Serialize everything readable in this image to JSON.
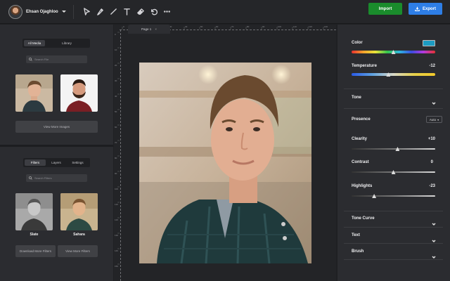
{
  "topbar": {
    "username": "Ehsan Ojaghloo",
    "tools": [
      "cursor-icon",
      "pen-icon",
      "line-icon",
      "text-icon",
      "eraser-icon",
      "undo-icon",
      "more-icon"
    ],
    "import_label": "Import",
    "export_label": "Export"
  },
  "media": {
    "tabs": [
      "All Media",
      "Library"
    ],
    "active_tab": "All Media",
    "search_placeholder": "Search File",
    "view_more_label": "View More Images"
  },
  "filters": {
    "tabs": [
      "Filters",
      "Layers",
      "Settings"
    ],
    "active_tab": "Filters",
    "search_placeholder": "Search Filters",
    "items": [
      {
        "name": "Slate"
      },
      {
        "name": "Sahara"
      }
    ],
    "download_label": "Download More Filters",
    "view_more_label": "View More Filters"
  },
  "canvas": {
    "page_tab": "Page 1",
    "page_tab_close": "×",
    "ruler_top": [
      "0",
      "10",
      "20",
      "30",
      "40",
      "50",
      "60",
      "70",
      "80",
      "90",
      "100",
      "110",
      "120",
      "130"
    ],
    "ruler_left": [
      "0",
      "10",
      "20",
      "30",
      "40",
      "50",
      "60",
      "70",
      "80",
      "90",
      "100",
      "110",
      "120",
      "130",
      "140",
      "150"
    ]
  },
  "adjust": {
    "color_label": "Color",
    "color_value": "#1c9bc2",
    "color_level": 0.5,
    "temperature_label": "Temperature",
    "temperature_value": "-12",
    "temperature_level": 0.44,
    "tone_label": "Tone",
    "presence_label": "Presence",
    "presence_mode": "Auto",
    "clearity_label": "Clearity",
    "clearity_value": "+10",
    "clearity_level": 0.55,
    "contrast_label": "Contrast",
    "contrast_value": "0",
    "contrast_level": 0.5,
    "highlights_label": "Highlights",
    "highlights_value": "-23",
    "highlights_level": 0.27,
    "tone_curve_label": "Tone Curve",
    "text_label": "Text",
    "brush_label": "Brush"
  }
}
